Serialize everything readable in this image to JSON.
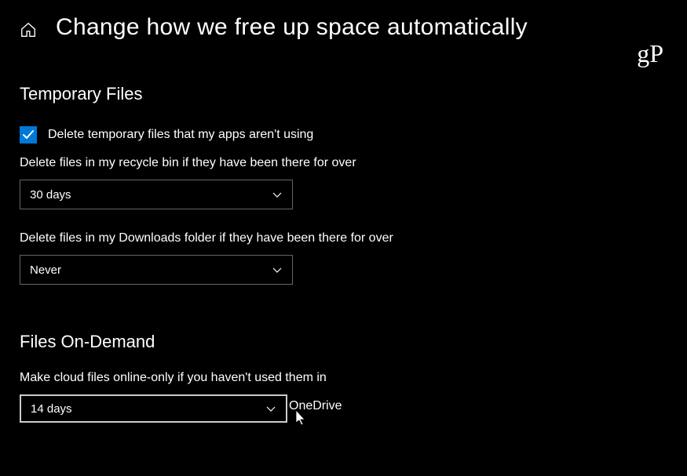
{
  "header": {
    "title": "Change how we free up space automatically"
  },
  "watermark": "gP",
  "sections": {
    "temporary_files": {
      "heading": "Temporary Files",
      "checkbox_label": "Delete temporary files that my apps aren't using",
      "recycle_bin": {
        "label": "Delete files in my recycle bin if they have been there for over",
        "value": "30 days"
      },
      "downloads": {
        "label": "Delete files in my Downloads folder if they have been there for over",
        "value": "Never"
      }
    },
    "files_on_demand": {
      "heading": "Files On-Demand",
      "cloud_files": {
        "label": "Make cloud files online-only if you haven't used them in",
        "value": "14 days",
        "service": "OneDrive"
      }
    }
  }
}
